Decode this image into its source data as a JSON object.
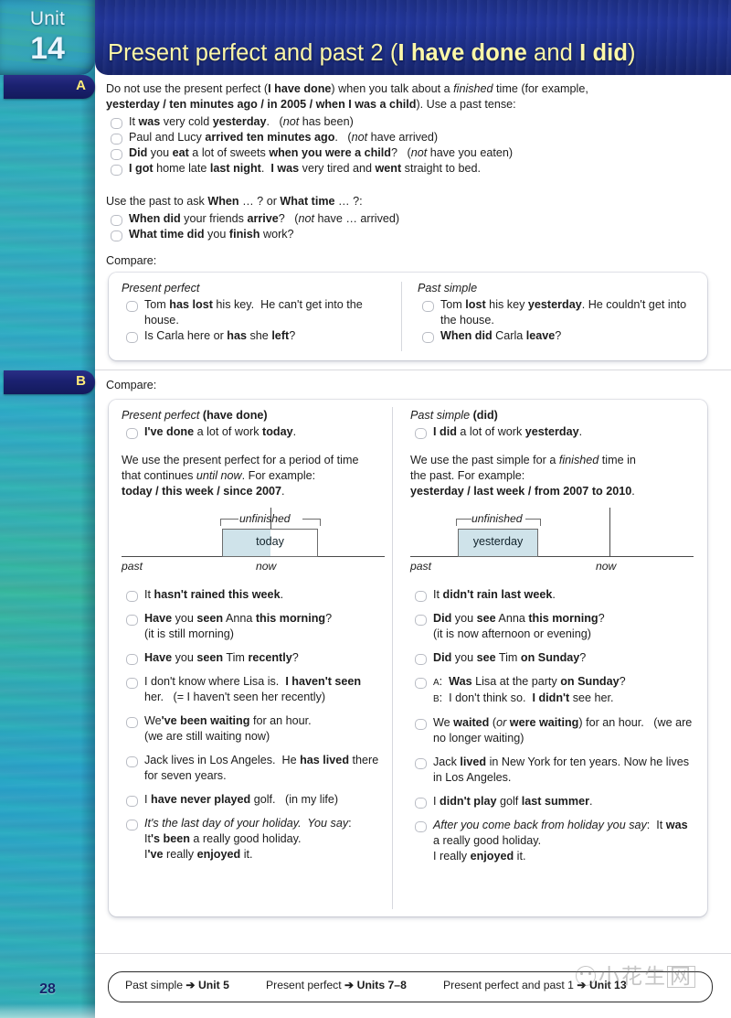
{
  "unit": {
    "label": "Unit",
    "number": "14"
  },
  "header": {
    "title_plain_1": "Present perfect and past 2 (",
    "title_bold_1": "I have done",
    "title_plain_2": " and ",
    "title_bold_2": "I did",
    "title_plain_3": ")",
    "title_full": "Present perfect and past 2 (I have done and I did)"
  },
  "sections": {
    "a": {
      "tab": "A",
      "intro_line1": "Do not use the present perfect (I have done) when you talk about a finished time (for example,",
      "intro_line2": "yesterday / ten minutes ago / in 2005 / when I was a child).  Use a past tense:",
      "bullets": [
        "It was very cold yesterday.   (not has been)",
        "Paul and Lucy arrived ten minutes ago.   (not have arrived)",
        "Did you eat a lot of sweets when you were a child?   (not have you eaten)",
        "I got home late last night.  I was very tired and went straight to bed."
      ],
      "past_intro": "Use the past to ask When … ? or What time … ?:",
      "past_bullets": [
        "When did your friends arrive?   (not have … arrived)",
        "What time did you finish work?"
      ],
      "compare_label": "Compare:",
      "compare": {
        "left_head": "Present perfect",
        "left_items": [
          "Tom has lost his key.  He can't get into the house.",
          "Is Carla here or has she left?"
        ],
        "right_head": "Past simple",
        "right_items": [
          "Tom lost his key yesterday. He couldn't get into the house.",
          "When did Carla leave?"
        ]
      }
    },
    "b": {
      "tab": "B",
      "compare_label": "Compare:",
      "left": {
        "head_italic": "Present perfect",
        "head_bold": "(have done)",
        "head_bullet": "I've done a lot of work today.",
        "explain_line1": "We use the present perfect for a period of time",
        "explain_line2": "that continues until now.  For example:",
        "explain_line3": "today / this week / since 2007.",
        "timeline": {
          "unfinished_label": "unfinished",
          "box_label": "today",
          "past_label": "past",
          "now_label": "now"
        },
        "examples": [
          "It hasn't rained this week.",
          "Have you seen Anna this morning? (it is still morning)",
          "Have you seen Tim recently?",
          "I don't know where Lisa is.  I haven't seen her.   (= I haven't seen her recently)",
          "We've been waiting for an hour. (we are still waiting now)",
          "Jack lives in Los Angeles.  He has lived there for seven years.",
          "I have never played golf.   (in my life)",
          "It's the last day of your holiday.  You say: It's been a really good holiday. I've really enjoyed it."
        ]
      },
      "right": {
        "head_italic": "Past simple",
        "head_bold": "(did)",
        "head_bullet": "I did a lot of work yesterday.",
        "explain_line1": "We use the past simple for a finished time in",
        "explain_line2": "the past.  For example:",
        "explain_line3": "yesterday / last week / from 2007 to 2010.",
        "timeline": {
          "unfinished_label": "unfinished",
          "box_label": "yesterday",
          "past_label": "past",
          "now_label": "now"
        },
        "examples": [
          "It didn't rain last week.",
          "Did you see Anna this morning? (it is now afternoon or evening)",
          "Did you see Tim on Sunday?",
          "A: Was Lisa at the party on Sunday? B: I don't think so.  I didn't see her.",
          "We waited (or were waiting) for an hour.   (we are no longer waiting)",
          "Jack lived in New York for ten years. Now he lives in Los Angeles.",
          "I didn't play golf last summer.",
          "After you come back from holiday you say:  It was a really good holiday. I really enjoyed it."
        ]
      }
    }
  },
  "footer": {
    "page_number": "28",
    "links": [
      {
        "text": "Past simple",
        "arrow": "➔",
        "target": "Unit 5"
      },
      {
        "text": "Present perfect",
        "arrow": "➔",
        "target": "Units 7–8"
      },
      {
        "text": "Present perfect and past 1",
        "arrow": "➔",
        "target": "Unit 13"
      }
    ]
  },
  "watermark": {
    "text": "小花生",
    "boxed": "网"
  },
  "colors": {
    "header_navy": "#1d2f84",
    "title_yellow": "#fdf8a8",
    "margin_teal": "#35a3c2",
    "tab_navy": "#1b2170",
    "tab_letter": "#ffec7a",
    "timeline_fill": "#cfe3ea",
    "page_number": "#16246b"
  }
}
